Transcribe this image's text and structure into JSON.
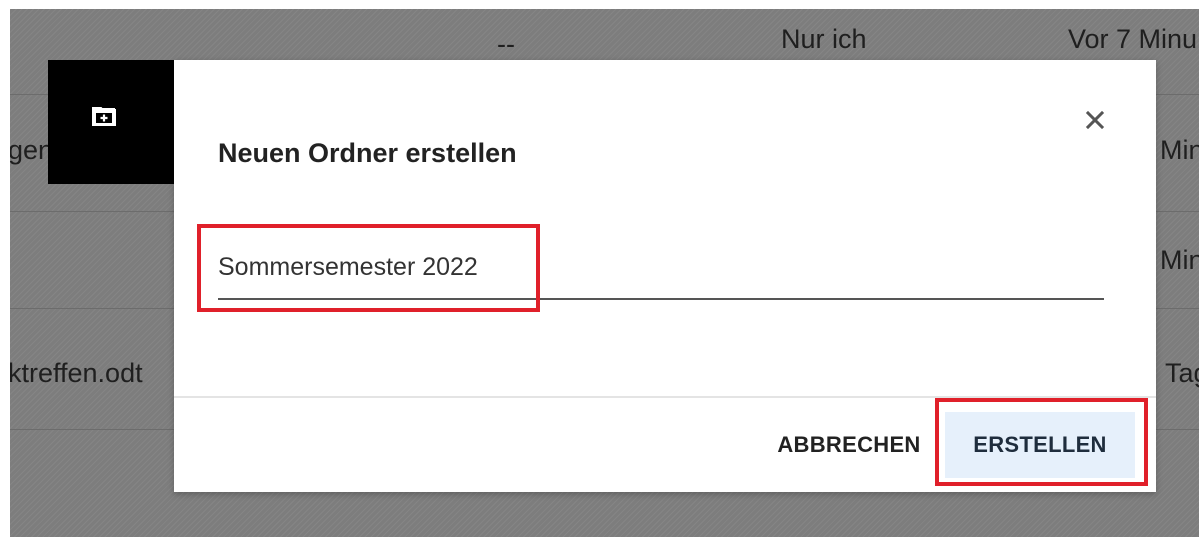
{
  "background": {
    "row1": {
      "col_dash": "--",
      "col_share": "Nur ich",
      "col_modified": "Vor 7 Minu"
    },
    "row2": {
      "left_fragment": "gen",
      "right_fragment": "Minu"
    },
    "row3": {
      "right_fragment": "Minu"
    },
    "row4": {
      "left_fragment": "ktreffen.odt",
      "right_fragment": "Tag"
    }
  },
  "dialog": {
    "icon": "folder-plus-icon",
    "close_icon": "close-icon",
    "title": "Neuen Ordner erstellen",
    "folder_name_value": "Sommersemester 2022",
    "cancel_label": "ABBRECHEN",
    "create_label": "ERSTELLEN"
  },
  "colors": {
    "highlight_box": "#e0202a",
    "primary_button_bg": "#e6f0fb",
    "icon_tile_bg": "#000000"
  }
}
